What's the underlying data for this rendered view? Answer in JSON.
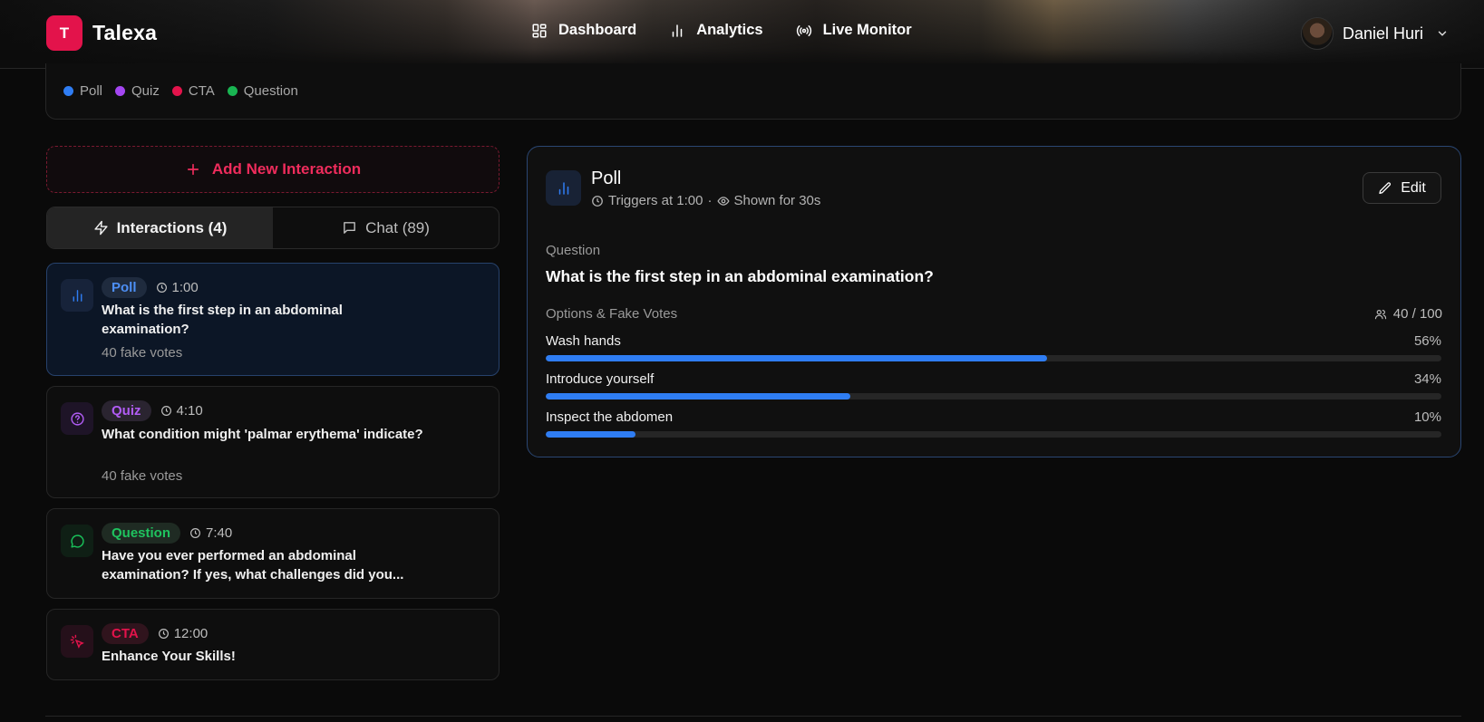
{
  "app": {
    "logo_letter": "T",
    "name": "Talexa"
  },
  "nav": [
    {
      "label": "Dashboard",
      "icon": "dashboard-icon"
    },
    {
      "label": "Analytics",
      "icon": "bar-chart-icon"
    },
    {
      "label": "Live Monitor",
      "icon": "broadcast-icon"
    }
  ],
  "user": {
    "name": "Daniel Huri"
  },
  "legend": [
    {
      "label": "Poll",
      "color": "#2f7df3"
    },
    {
      "label": "Quiz",
      "color": "#a446f2"
    },
    {
      "label": "CTA",
      "color": "#e3134b"
    },
    {
      "label": "Question",
      "color": "#19b552"
    }
  ],
  "add_button": "Add New Interaction",
  "tabs": [
    {
      "label": "Interactions (4)",
      "active": true
    },
    {
      "label": "Chat (89)",
      "active": false
    }
  ],
  "interactions": [
    {
      "type": "Poll",
      "time": "1:00",
      "question": "What is the first step in an abdominal examination?",
      "votes": "40 fake votes",
      "color": "#2f7df3",
      "icon": "bar-chart-icon"
    },
    {
      "type": "Quiz",
      "time": "4:10",
      "question": "What condition might 'palmar erythema' indicate?",
      "votes": "40 fake votes",
      "color": "#a446f2",
      "icon": "question-circle-icon"
    },
    {
      "type": "Question",
      "time": "7:40",
      "question": "Have you ever performed an abdominal examination? If yes, what challenges did you...",
      "color": "#19b552",
      "icon": "chat-bubble-icon"
    },
    {
      "type": "CTA",
      "time": "12:00",
      "question": "Enhance Your Skills!",
      "color": "#e3134b",
      "icon": "pointer-click-icon"
    }
  ],
  "detail": {
    "type": "Poll",
    "triggers": "Triggers at 1:00",
    "separator": "·",
    "shown": "Shown for 30s",
    "edit": "Edit",
    "question_label": "Question",
    "question": "What is the first step in an abdominal examination?",
    "options_label": "Options & Fake Votes",
    "votes_count": "40 / 100",
    "options": [
      {
        "label": "Wash hands",
        "percent": "56%",
        "value": 56
      },
      {
        "label": "Introduce yourself",
        "percent": "34%",
        "value": 34
      },
      {
        "label": "Inspect the abdomen",
        "percent": "10%",
        "value": 10
      }
    ]
  }
}
